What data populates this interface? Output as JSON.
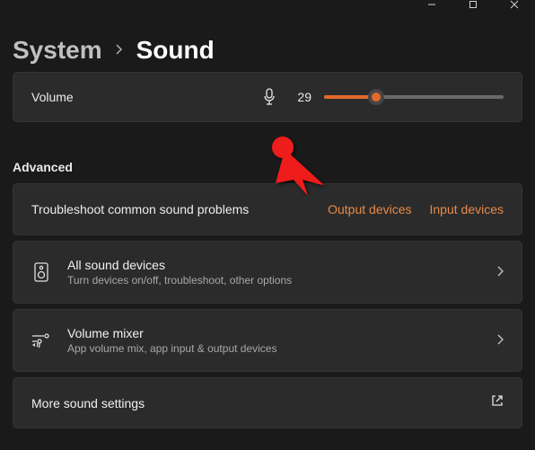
{
  "window_controls": {
    "minimize": "min",
    "maximize": "max",
    "close": "close"
  },
  "breadcrumb": {
    "parent": "System",
    "current": "Sound"
  },
  "volume": {
    "label": "Volume",
    "value": "29",
    "percent": 29
  },
  "section_advanced": "Advanced",
  "troubleshoot": {
    "label": "Troubleshoot common sound problems",
    "output_link": "Output devices",
    "input_link": "Input devices"
  },
  "rows": {
    "all_devices": {
      "title": "All sound devices",
      "sub": "Turn devices on/off, troubleshoot, other options"
    },
    "mixer": {
      "title": "Volume mixer",
      "sub": "App volume mix, app input & output devices"
    },
    "more": {
      "title": "More sound settings"
    }
  },
  "accent": "#e06a2b"
}
